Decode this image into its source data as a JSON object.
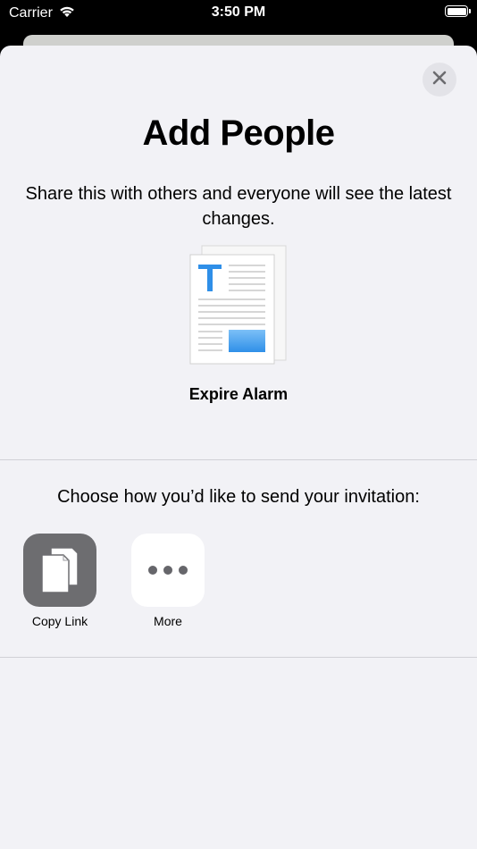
{
  "status_bar": {
    "carrier": "Carrier",
    "time": "3:50 PM",
    "wifi_icon": "wifi-icon",
    "battery_icon": "battery-icon"
  },
  "sheet": {
    "close_icon": "close-icon",
    "title": "Add People",
    "subtitle": "Share this with others and everyone will see the latest changes.",
    "document": {
      "icon": "text-document-icon",
      "name": "Expire Alarm"
    },
    "send_prompt": "Choose how you’d like to send your invitation:",
    "share_options": [
      {
        "label": "Copy Link",
        "icon": "copy-link-icon"
      },
      {
        "label": "More",
        "icon": "more-icon"
      }
    ]
  },
  "colors": {
    "background": "#000000",
    "sheet": "#f2f2f6",
    "back_card": "#cfd0cd",
    "close_button": "#e3e3e8",
    "copy_link_tile": "#6d6d70",
    "more_tile": "#ffffff",
    "doc_accent": "#2f8fe8"
  }
}
